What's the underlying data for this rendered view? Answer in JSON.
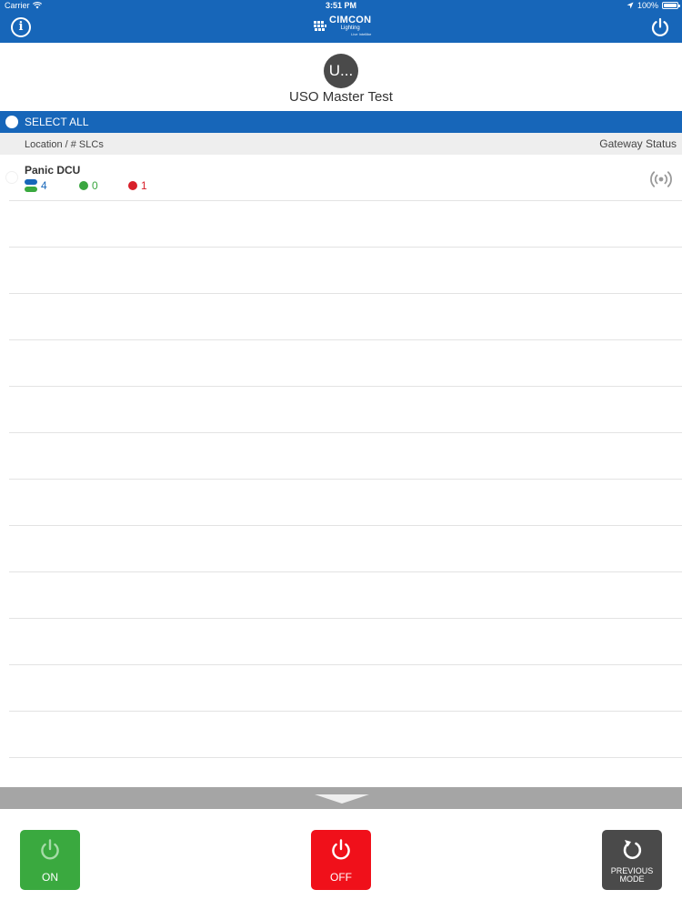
{
  "status_bar": {
    "carrier": "Carrier",
    "time": "3:51 PM",
    "battery": "100%"
  },
  "nav": {
    "logo_brand": "CIMCON",
    "logo_sub": "Lighting",
    "logo_tagline": "Live Intellibe",
    "info_icon": "info-icon",
    "power_icon": "power-icon"
  },
  "user": {
    "avatar_text": "U...",
    "name": "USO Master Test"
  },
  "select_all": {
    "label": "SELECT ALL"
  },
  "table": {
    "col_location": "Location / # SLCs",
    "col_gateway": "Gateway Status"
  },
  "rows": [
    {
      "name": "Panic DCU",
      "total_slcs": "4",
      "on_count": "0",
      "off_count": "1",
      "gateway_icon": "signal-broadcast-icon"
    }
  ],
  "empty_rows": 12,
  "actions": {
    "on_label": "ON",
    "off_label": "OFF",
    "previous_label_line1": "PREVIOUS",
    "previous_label_line2": "MODE"
  },
  "colors": {
    "primary_blue": "#1766b9",
    "on_green": "#3aa93f",
    "off_red": "#f0101a",
    "dark_gray": "#4a4a4a"
  }
}
